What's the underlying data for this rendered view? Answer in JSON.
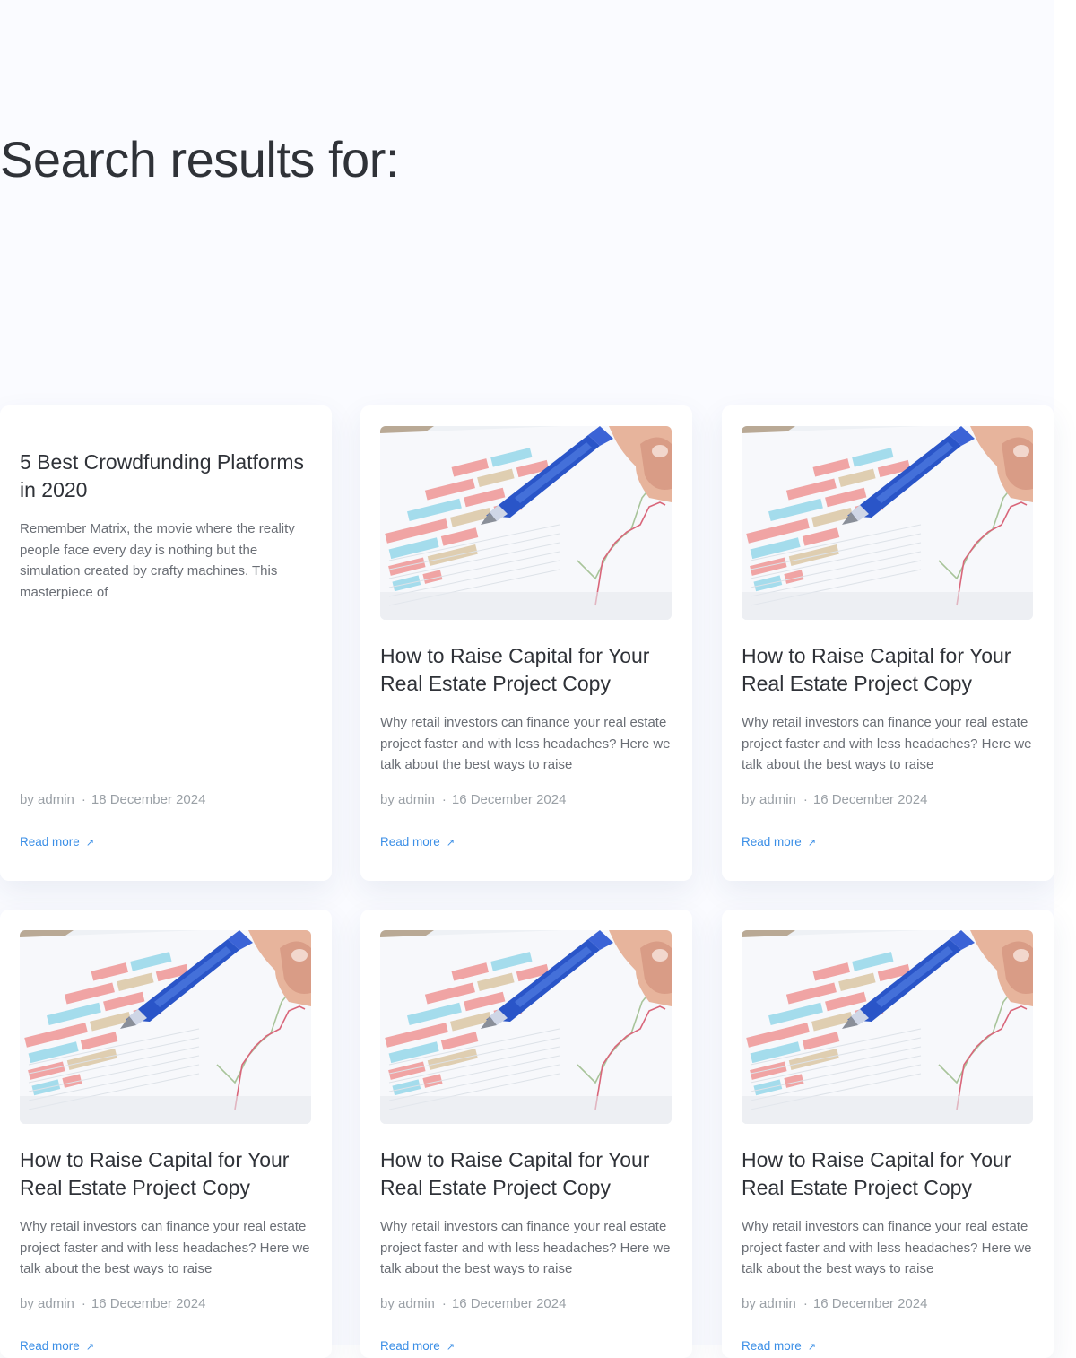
{
  "page": {
    "title": "Search results for:"
  },
  "posts": [
    {
      "title": "5 Best Crowdfunding Platforms in 2020",
      "excerpt": "Remember Matrix, the movie where the reality people face every day is nothing but the simulation created by crafty machines. This masterpiece of",
      "author": "by admin",
      "date": "18 December 2024",
      "read_more": "Read more",
      "has_image": false
    },
    {
      "title": "How to Raise Capital for Your Real Estate Project Copy",
      "excerpt": "Why retail investors can finance your real estate project faster and with less headaches? Here we talk about the best ways to raise",
      "author": "by admin",
      "date": "16 December 2024",
      "read_more": "Read more",
      "has_image": true
    },
    {
      "title": "How to Raise Capital for Your Real Estate Project Copy",
      "excerpt": "Why retail investors can finance your real estate project faster and with less headaches? Here we talk about the best ways to raise",
      "author": "by admin",
      "date": "16 December 2024",
      "read_more": "Read more",
      "has_image": true
    },
    {
      "title": "How to Raise Capital for Your Real Estate Project Copy",
      "excerpt": "Why retail investors can finance your real estate project faster and with less headaches? Here we talk about the best ways to raise",
      "author": "by admin",
      "date": "16 December 2024",
      "read_more": "Read more",
      "has_image": true
    },
    {
      "title": "How to Raise Capital for Your Real Estate Project Copy",
      "excerpt": "Why retail investors can finance your real estate project faster and with less headaches? Here we talk about the best ways to raise",
      "author": "by admin",
      "date": "16 December 2024",
      "read_more": "Read more",
      "has_image": true
    },
    {
      "title": "How to Raise Capital for Your Real Estate Project Copy",
      "excerpt": "Why retail investors can finance your real estate project faster and with less headaches? Here we talk about the best ways to raise",
      "author": "by admin",
      "date": "16 December 2024",
      "read_more": "Read more",
      "has_image": true
    }
  ],
  "icons": {
    "read_more_arrow": "arrow-up-right-icon",
    "meta_separator": "·"
  },
  "colors": {
    "link": "#3a8ee6",
    "heading": "#2f3238",
    "page_background": "#fafbff"
  }
}
